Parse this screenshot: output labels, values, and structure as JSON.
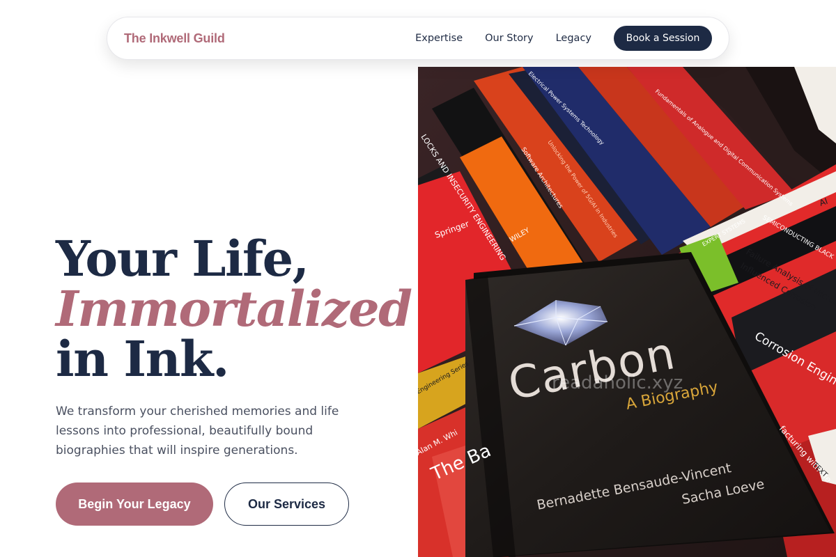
{
  "nav": {
    "brand": "The Inkwell Guild",
    "links": [
      {
        "label": "Expertise"
      },
      {
        "label": "Our Story"
      },
      {
        "label": "Legacy"
      }
    ],
    "cta": "Book a Session"
  },
  "hero": {
    "headline_line1": "Your Life,",
    "headline_line2": "Immortalized",
    "headline_line3": "in Ink.",
    "subtext": "We transform your cherished memories and life lessons into professional, beautifully bound biographies that will inspire generations.",
    "primary_button": "Begin Your Legacy",
    "secondary_button": "Our Services"
  },
  "image": {
    "book_title": "Carbon",
    "book_subtitle": "A Biography",
    "author_1": "Bernadette Bensaude-Vincent",
    "author_2": "Sacha Loeve",
    "watermark": "readaholic.xyz",
    "spine_texts": [
      "LOCKS AND INSECURITY ENGINEERING",
      "Springer",
      "WILEY",
      "Software Architectures",
      "Unlocking the Power of 5G/AI in Industries",
      "Electrical Power Systems Technology",
      "Fundamentals of Analogue and Digital Communication Systems",
      "Failure Analysis of Microelectronics",
      "Influenced Corrosion",
      "Corrosion Engineering",
      "SEMICONDUCTING BLACK",
      "EXPERT SYSTEMS",
      "Engineering Series",
      "Alan M. Whi",
      "The Ba",
      "facturing with Me",
      "TEXT",
      "AI"
    ]
  },
  "colors": {
    "brand": "#b06a78",
    "navy": "#1d2a44",
    "body_text": "#4a5060"
  }
}
